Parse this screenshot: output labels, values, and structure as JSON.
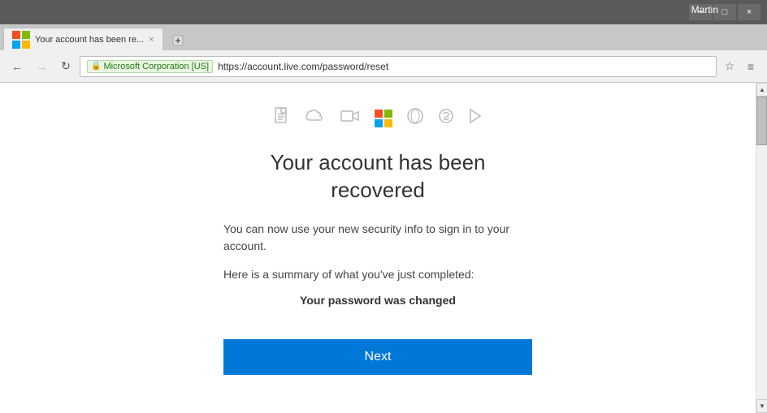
{
  "titleBar": {
    "user": "Martin",
    "minimizeLabel": "−",
    "maximizeLabel": "□",
    "closeLabel": "×"
  },
  "tab": {
    "title": "Your account has been re...",
    "closeLabel": "×"
  },
  "navbar": {
    "backLabel": "←",
    "forwardLabel": "→",
    "refreshLabel": "↻",
    "sslBadge": "Microsoft Corporation [US]",
    "url": "https://account.live.com/password/reset",
    "menuLabel": "≡"
  },
  "page": {
    "heading": "Your account has been\nrecovered",
    "description": "You can now use your new security info to sign in to your account.",
    "summary": "Here is a summary of what you've just completed:",
    "passwordChanged": "Your password was changed",
    "nextButton": "Next"
  },
  "icons": {
    "pageIcon": "📄",
    "cloudIcon": "☁",
    "videoIcon": "📹",
    "xboxIcon": "⊙",
    "skypeIcon": "S",
    "arrowIcon": "▶"
  }
}
